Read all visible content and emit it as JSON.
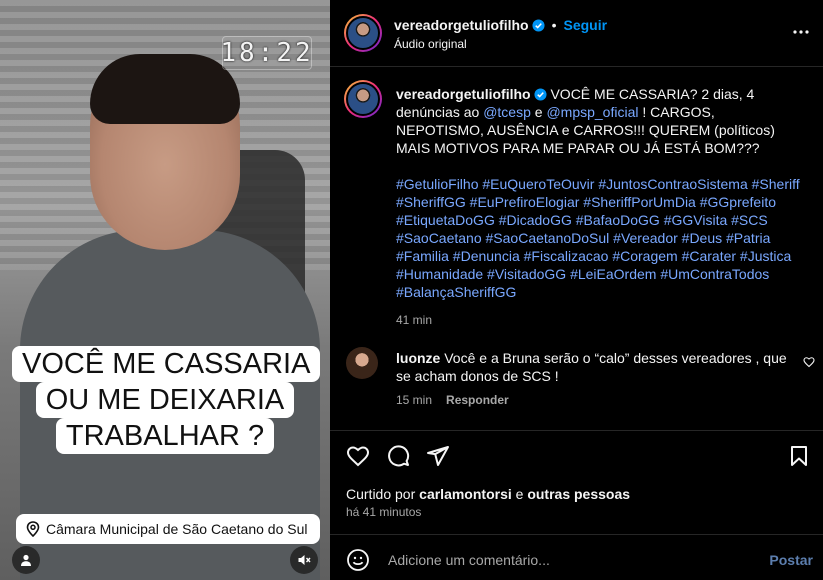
{
  "video": {
    "clock_text": "18:22",
    "caption": "VOCÊ ME CASSARIA OU ME DEIXARIA TRABALHAR ?",
    "location": "Câmara Municipal de São Caetano do Sul"
  },
  "header": {
    "username": "vereadorgetuliofilho",
    "separator": "•",
    "follow_label": "Seguir",
    "audio_label": "Áudio original"
  },
  "post": {
    "username": "vereadorgetuliofilho",
    "text_part1": "VOCÊ ME CASSARIA? 2 dias, 4 denúncias ao",
    "mention1": "@tcesp",
    "text_e": "e",
    "mention2": "@mpsp_oficial",
    "text_part2": "! CARGOS, NEPOTISMO, AUSÊNCIA e CARROS!!! QUEREM (políticos) MAIS MOTIVOS PARA ME PARAR OU JÁ ESTÁ BOM???",
    "hashtags": "#GetulioFilho #EuQueroTeOuvir #JuntosContraoSistema #Sheriff #SheriffGG #EuPrefiroElogiar #SheriffPorUmDia #GGprefeito #EtiquetaDoGG #DicadoGG #BafaoDoGG #GGVisita #SCS #SaoCaetano #SaoCaetanoDoSul #Vereador #Deus #Patria #Familia #Denuncia #Fiscalizacao #Coragem #Carater #Justica #Humanidade #VisitadoGG #LeiEaOrdem #UmContraTodos #BalançaSheriffGG",
    "time": "41 min"
  },
  "comment": {
    "username": "luonze",
    "text": "Você e a Bruna serão o “calo” desses vereadores , que se acham donos de SCS !",
    "time": "15 min",
    "reply_label": "Responder"
  },
  "likes": {
    "prefix": "Curtido por",
    "user": "carlamontorsi",
    "connector": "e",
    "others": "outras pessoas"
  },
  "posted_ago": "há 41 minutos",
  "comment_input": {
    "placeholder": "Adicione um comentário...",
    "post_label": "Postar"
  },
  "colors": {
    "follow_blue": "#0095f6",
    "link_blue": "#7aa8ff",
    "muted": "#a8a8a8"
  }
}
